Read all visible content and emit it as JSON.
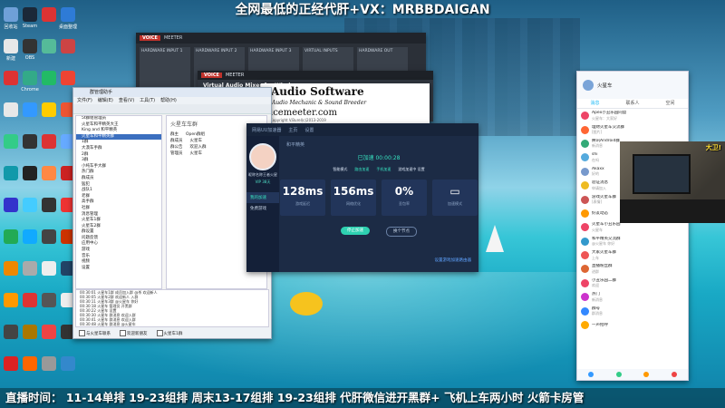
{
  "banner": {
    "text": "全网最低的正经代肝+VX：MRBBDAIGAN"
  },
  "ticker": {
    "text": "直播时间： 11-14单排 19-23组排 周末13-17组排 19-23组排 代肝微信进开黑群+ 飞机上车两小时 火箭卡房管"
  },
  "desktop_icons": [
    {
      "label": "回收站",
      "color": "#6fa0d8"
    },
    {
      "label": "Steam",
      "color": "#1b2838"
    },
    {
      "label": "",
      "color": "#d33"
    },
    {
      "label": "桌面整理",
      "color": "#2e7bd6"
    },
    {
      "label": "新建",
      "color": "#e8e8e8"
    },
    {
      "label": "OBS",
      "color": "#333"
    },
    {
      "label": "",
      "color": "#5b9"
    },
    {
      "label": "",
      "color": "#c44"
    },
    {
      "label": "",
      "color": "#d33"
    },
    {
      "label": "Chrome",
      "color": "#3a8"
    },
    {
      "label": "",
      "color": "#2b6"
    },
    {
      "label": "",
      "color": "#e43"
    },
    {
      "label": "",
      "color": "#e8e8e8"
    },
    {
      "label": "",
      "color": "#39f"
    },
    {
      "label": "",
      "color": "#fc0"
    },
    {
      "label": "",
      "color": "#e53"
    },
    {
      "label": "",
      "color": "#3c8"
    },
    {
      "label": "",
      "color": "#333"
    },
    {
      "label": "",
      "color": "#d33"
    },
    {
      "label": "",
      "color": "#6af"
    },
    {
      "label": "",
      "color": "#19a"
    },
    {
      "label": "",
      "color": "#222"
    },
    {
      "label": "",
      "color": "#f84"
    },
    {
      "label": "",
      "color": "#c22"
    },
    {
      "label": "",
      "color": "#33c"
    },
    {
      "label": "",
      "color": "#4cf"
    },
    {
      "label": "",
      "color": "#333"
    },
    {
      "label": "",
      "color": "#e33"
    },
    {
      "label": "",
      "color": "#2a5"
    },
    {
      "label": "",
      "color": "#1af"
    },
    {
      "label": "",
      "color": "#444"
    },
    {
      "label": "",
      "color": "#c30"
    },
    {
      "label": "",
      "color": "#e80"
    },
    {
      "label": "",
      "color": "#aaa"
    },
    {
      "label": "",
      "color": "#eee"
    },
    {
      "label": "",
      "color": "#246"
    },
    {
      "label": "",
      "color": "#f90"
    },
    {
      "label": "",
      "color": "#d33"
    },
    {
      "label": "",
      "color": "#555"
    },
    {
      "label": "",
      "color": "#eee"
    },
    {
      "label": "",
      "color": "#444"
    },
    {
      "label": "",
      "color": "#a70"
    },
    {
      "label": "",
      "color": "#e44"
    },
    {
      "label": "",
      "color": "#333"
    },
    {
      "label": "",
      "color": "#d22"
    },
    {
      "label": "",
      "color": "#f60"
    },
    {
      "label": "",
      "color": "#999"
    },
    {
      "label": "",
      "color": "#38c"
    }
  ],
  "voicemeeter": {
    "brand": "VOICE",
    "name": "MEETER",
    "strips": [
      "HARDWARE INPUT 1",
      "HARDWARE INPUT 2",
      "HARDWARE INPUT 3",
      "VIRTUAL INPUTS",
      "HARDWARE OUT"
    ]
  },
  "voicemeeter2": {
    "title": "Virtual Audio Mixer for Windows"
  },
  "vas": {
    "heading": "-Audio Software",
    "subtitle": "Audio Mechanic & Sound Breeder",
    "url": "icemeeter.com",
    "copyright": "Copyright V.Burel(c)2013-2019"
  },
  "qq_group_window": {
    "title": "群管理助手",
    "menu": [
      "文件(F)",
      "编辑(E)",
      "查看(V)",
      "工具(T)",
      "帮助(H)"
    ],
    "tree": [
      "5t群组管理员",
      "火星车和平精英大王",
      "King and 和平精英",
      "火星车和平精英群",
      "1群",
      "大漠车手群",
      "2群",
      "3群",
      "小纯车手大群",
      "热门群",
      "群成员",
      "猛犯",
      "战队1",
      "老群",
      "高手群",
      "社群",
      "消息管理",
      "火星车1群",
      "火星车2群",
      "群设置",
      "问题反馈",
      "应用中心",
      "游戏",
      "音乐",
      "视频",
      "设置"
    ],
    "selected_index": 3,
    "detail_title": "火星车车群",
    "rows": [
      [
        "群主",
        "Open群组"
      ],
      [
        "群成员",
        "火星车"
      ],
      [
        "群公告",
        "欢迎入群"
      ],
      [
        "管理员",
        "火星车"
      ]
    ],
    "log": [
      "00:30:01 火星车1群 成员加入群 @杀 欢迎新人",
      "00:30:05 火星车2群 欢迎新人 入群",
      "00:30:11 火星车3群 @火星车 你好",
      "00:30:18 火星车 管理员 开黑群",
      "00:30:22 火星车 设置",
      "00:30:30 火星车 群消息 欢迎入群",
      "00:30:41 火星车 群消息 欢迎入群",
      "00:30:48 火星车 群消息 @火星车"
    ],
    "footer": [
      "与火星车联系",
      "欢迎新朋友",
      "火星车1群"
    ]
  },
  "accelerator": {
    "title_items": [
      "网易UU加速器",
      "主页",
      "设置"
    ],
    "user": "昵称名称王者火星",
    "vip": "VIP 38天",
    "nav": [
      "我的加速",
      "免费游戏"
    ],
    "nav_active": 0,
    "game_label": "和平精英",
    "status": "已加速 00:00:28",
    "pills": [
      "智能模式",
      "路由加速",
      "手机加速",
      "游戏加速中 设置"
    ],
    "stats": [
      {
        "value": "128",
        "unit": "ms",
        "label": "游戏延迟"
      },
      {
        "value": "156",
        "unit": "ms",
        "label": "网络优化"
      },
      {
        "value": "0",
        "unit": "%",
        "label": "丢包率"
      },
      {
        "value": "",
        "unit": "",
        "label": "加速模式"
      }
    ],
    "primary_button": "停止加速",
    "secondary_button": "换个节点",
    "footer_link": "设置游戏加速路由器"
  },
  "qq_list": {
    "name": "火星车",
    "tabs": [
      "消息",
      "联系人",
      "空间"
    ],
    "active_tab": 0,
    "items": [
      {
        "name": "Apex小丑乐园同盟",
        "preview": "火星车：大家好",
        "color": "#e46"
      },
      {
        "name": "理财火星车交流群",
        "preview": "[图片]",
        "color": "#f63"
      },
      {
        "name": "腾讯Android群",
        "preview": "新消息",
        "color": "#3a7"
      },
      {
        "name": "shi",
        "preview": "在吗",
        "color": "#5ad"
      },
      {
        "name": "Akaxx",
        "preview": "好的",
        "color": "#79c"
      },
      {
        "name": "验证消息",
        "preview": "申请加入",
        "color": "#eb2"
      },
      {
        "name": "游戏火星车群",
        "preview": "[表情]",
        "color": "#c55"
      },
      {
        "name": "好友动态",
        "preview": "",
        "color": "#f90"
      },
      {
        "name": "火星车小丑乐园",
        "preview": "火星车",
        "color": "#e46"
      },
      {
        "name": "和平精英交流群",
        "preview": "@火星车 你好",
        "color": "#39c"
      },
      {
        "name": "大家火星车群",
        "preview": "上车",
        "color": "#e55"
      },
      {
        "name": "直播粉丝群",
        "preview": "进群",
        "color": "#d63"
      },
      {
        "name": "小丑乐园二群",
        "preview": "欢迎",
        "color": "#e46"
      },
      {
        "name": "热门",
        "preview": "新消息",
        "color": "#c3c"
      },
      {
        "name": "群号",
        "preview": "群消息",
        "color": "#38f"
      },
      {
        "name": "一声招呼",
        "preview": "",
        "color": "#fa0"
      }
    ]
  },
  "webcam": {
    "tag": "大卫!"
  }
}
